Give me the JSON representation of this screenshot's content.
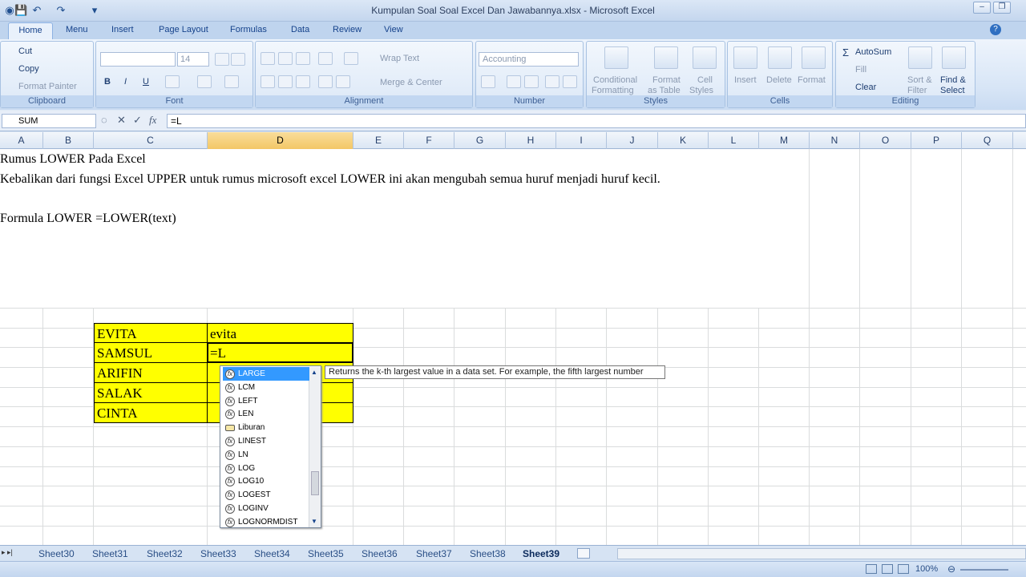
{
  "window": {
    "title": "Kumpulan Soal Soal Excel Dan Jawabannya.xlsx - Microsoft Excel",
    "min": "–",
    "restore": "❐",
    "close": "✕"
  },
  "ribbon_tabs": [
    "Home",
    "Menu",
    "Insert",
    "Page Layout",
    "Formulas",
    "Data",
    "Review",
    "View"
  ],
  "clipboard": {
    "cut": "Cut",
    "copy": "Copy",
    "format_painter": "Format Painter",
    "label": "Clipboard"
  },
  "font": {
    "size": "14",
    "label": "Font",
    "bold": "B",
    "italic": "I",
    "underline": "U"
  },
  "alignment": {
    "wrap_text": "Wrap Text",
    "merge_center": "Merge & Center",
    "label": "Alignment"
  },
  "number": {
    "format": "Accounting",
    "label": "Number"
  },
  "styles": {
    "conditional": "Conditional",
    "conditional2": "Formatting",
    "format_as": "Format",
    "format_as2": "as Table",
    "cell": "Cell",
    "cell2": "Styles",
    "label": "Styles"
  },
  "cells": {
    "insert": "Insert",
    "delete": "Delete",
    "format": "Format",
    "label": "Cells"
  },
  "editing": {
    "autosum": "AutoSum",
    "fill": "Fill",
    "clear": "Clear",
    "sort": "Sort &",
    "sort2": "Filter",
    "find": "Find &",
    "find2": "Select",
    "label": "Editing"
  },
  "formula_bar": {
    "name_box": "SUM",
    "content": "=L"
  },
  "columns": [
    "A",
    "B",
    "C",
    "D",
    "E",
    "F",
    "G",
    "H",
    "I",
    "J",
    "K",
    "L",
    "M",
    "N",
    "O",
    "P",
    "Q"
  ],
  "sheet_text": {
    "line1": "Rumus LOWER Pada Excel",
    "line2": "Kebalikan dari fungsi Excel UPPER untuk rumus microsoft excel LOWER ini akan mengubah semua huruf menjadi huruf kecil.",
    "line3": "Formula LOWER =LOWER(text)"
  },
  "table": [
    {
      "c": "EVITA",
      "d": "evita"
    },
    {
      "c": "SAMSUL",
      "d": "=L"
    },
    {
      "c": "ARIFIN",
      "d": ""
    },
    {
      "c": "SALAK",
      "d": ""
    },
    {
      "c": "CINTA",
      "d": ""
    }
  ],
  "autocomplete": {
    "items": [
      "LARGE",
      "LCM",
      "LEFT",
      "LEN",
      "Liburan",
      "LINEST",
      "LN",
      "LOG",
      "LOG10",
      "LOGEST",
      "LOGINV",
      "LOGNORMDIST"
    ],
    "selected": "LARGE",
    "tooltip": "Returns the k-th largest value in a data set. For example, the fifth largest number"
  },
  "sheets": [
    "Sheet30",
    "Sheet31",
    "Sheet32",
    "Sheet33",
    "Sheet34",
    "Sheet35",
    "Sheet36",
    "Sheet37",
    "Sheet38",
    "Sheet39"
  ],
  "active_sheet": "Sheet39",
  "status": {
    "zoom": "100%"
  }
}
